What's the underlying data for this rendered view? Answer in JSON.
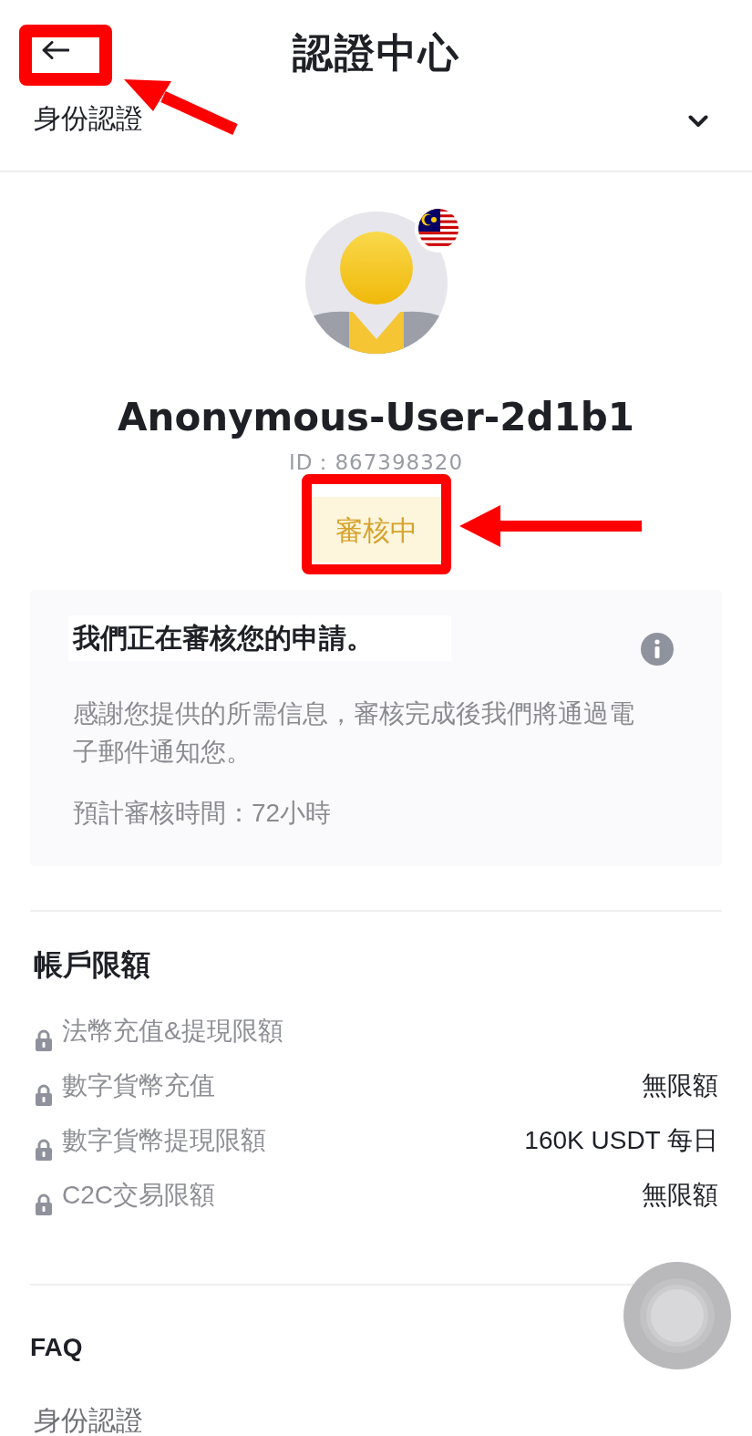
{
  "header": {
    "title": "認證中心",
    "back_button": {
      "highlighted": true
    }
  },
  "verification_dropdown": {
    "label": "身份認證"
  },
  "profile": {
    "username": "Anonymous-User-2d1b1",
    "user_id": "ID：867398320",
    "status": {
      "label": "審核中",
      "highlighted": true
    }
  },
  "notice": {
    "title": "我們正在審核您的申請。",
    "body": "感謝您提供的所需信息，審核完成後我們將通過電子郵件通知您。",
    "estimate": "預計審核時間：72小時"
  },
  "account_limits": {
    "title": "帳戶限額",
    "rows": [
      {
        "label": "法幣充值&提現限額",
        "locked": true
      },
      {
        "label": "數字貨幣充值",
        "value": "無限額",
        "locked": true
      },
      {
        "label": "數字貨幣提現限額",
        "value": "160K USDT 每日",
        "locked": true
      },
      {
        "label": "C2C交易限額",
        "value": "無限額",
        "locked": true
      }
    ]
  },
  "faq": {
    "title": "FAQ",
    "items": [
      {
        "label": "身份認證"
      }
    ]
  }
}
